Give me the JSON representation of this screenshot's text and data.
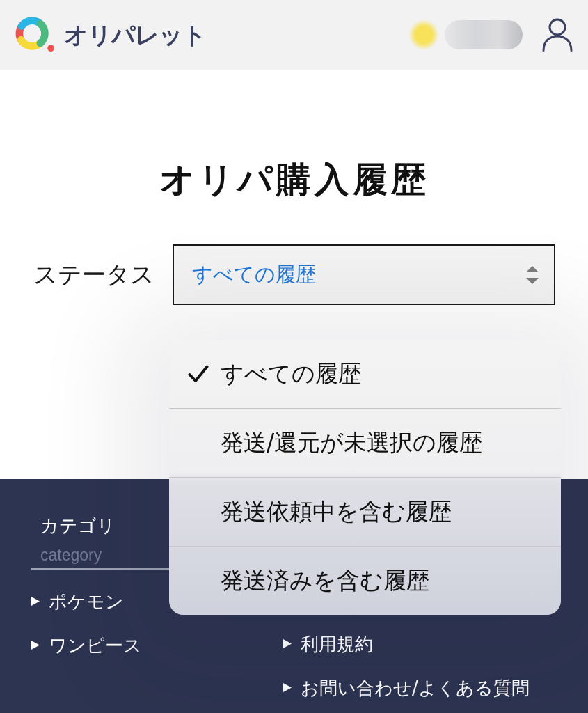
{
  "header": {
    "logo_text": "オリパレット"
  },
  "title": "オリパ購入履歴",
  "status_filter": {
    "label": "ステータス",
    "value": "すべての履歴",
    "expanded": true
  },
  "dropdown_options": [
    {
      "label": "すべての履歴",
      "selected": true
    },
    {
      "label": "発送/還元が未選択の履歴",
      "selected": false
    },
    {
      "label": "発送依頼中を含む履歴",
      "selected": false
    },
    {
      "label": "発送済みを含む履歴",
      "selected": false
    }
  ],
  "footer": {
    "category_section": {
      "heading": "カテゴリ",
      "subheading": "category",
      "links": [
        "ポケモン",
        "ワンピース"
      ]
    },
    "other_links": [
      "利用規約",
      "お問い合わせ/よくある質問"
    ]
  }
}
